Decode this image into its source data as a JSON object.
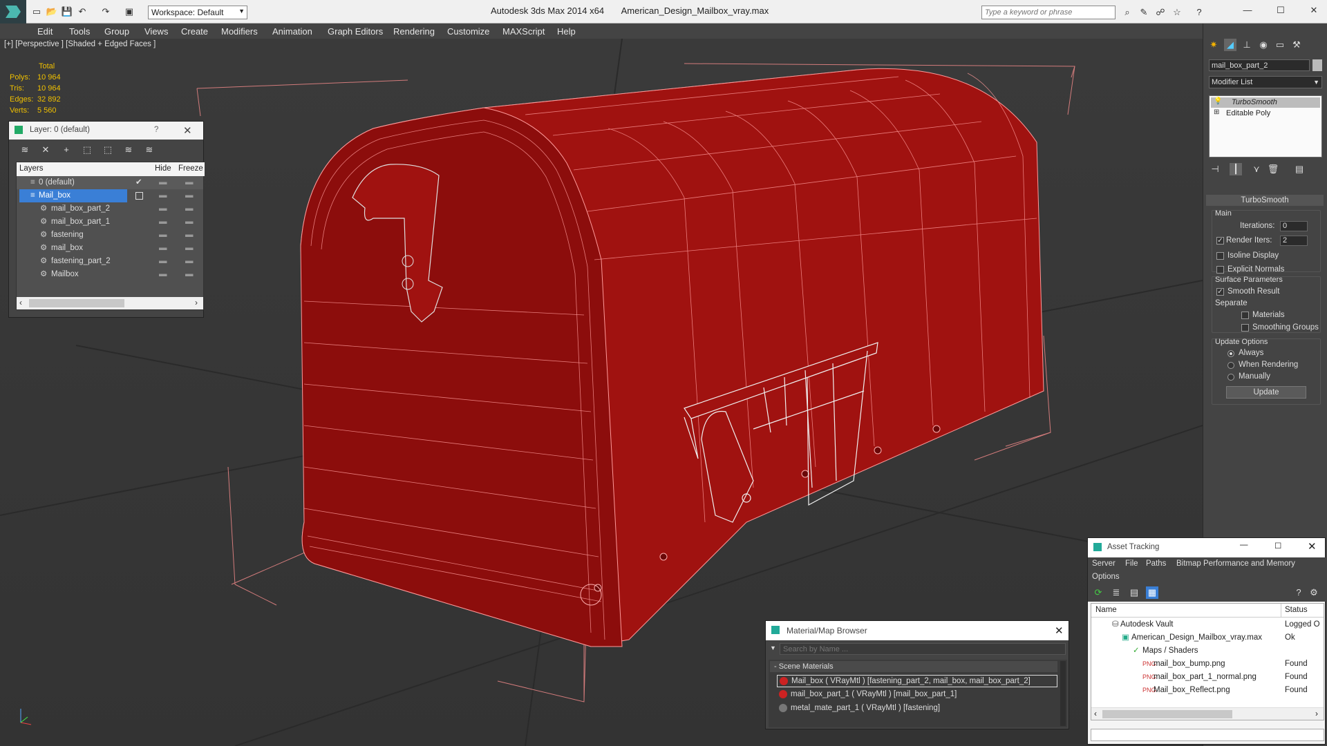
{
  "titlebar": {
    "app_title": "Autodesk 3ds Max  2014 x64",
    "file_title": "American_Design_Mailbox_vray.max",
    "workspace": "Workspace: Default",
    "search_placeholder": "Type a keyword or phrase"
  },
  "menu": [
    "Edit",
    "Tools",
    "Group",
    "Views",
    "Create",
    "Modifiers",
    "Animation",
    "Graph Editors",
    "Rendering",
    "Customize",
    "MAXScript",
    "Help"
  ],
  "viewport": {
    "label": "[+] [Perspective ] [Shaded + Edged Faces ]",
    "stats": {
      "header": "Total",
      "polys_label": "Polys:",
      "polys": "10 964",
      "tris_label": "Tris:",
      "tris": "10 964",
      "edges_label": "Edges:",
      "edges": "32 892",
      "verts_label": "Verts:",
      "verts": "5 560"
    }
  },
  "layer_window": {
    "title": "Layer: 0 (default)",
    "help": "?",
    "col_layers": "Layers",
    "col_hide": "Hide",
    "col_freeze": "Freeze",
    "rows": [
      {
        "name": "0 (default)"
      },
      {
        "name": "Mail_box"
      },
      {
        "name": "mail_box_part_2"
      },
      {
        "name": "mail_box_part_1"
      },
      {
        "name": "fastening"
      },
      {
        "name": "mail_box"
      },
      {
        "name": "fastening_part_2"
      },
      {
        "name": "Mailbox"
      }
    ]
  },
  "command_panel": {
    "object_name": "mail_box_part_2",
    "modifier_list": "Modifier List",
    "stack": [
      "TurboSmooth",
      "Editable Poly"
    ],
    "rollout_title": "TurboSmooth",
    "main_label": "Main",
    "iterations_label": "Iterations:",
    "iterations_value": "0",
    "render_iters_label": "Render Iters:",
    "render_iters_value": "2",
    "isoline": "Isoline Display",
    "explicit": "Explicit Normals",
    "surface_params": "Surface Parameters",
    "smooth_result": "Smooth Result",
    "separate": "Separate",
    "materials": "Materials",
    "smoothing_groups": "Smoothing Groups",
    "update_options": "Update Options",
    "always": "Always",
    "when_rendering": "When Rendering",
    "manually": "Manually",
    "update_btn": "Update"
  },
  "material_browser": {
    "title": "Material/Map Browser",
    "search_placeholder": "Search by Name ...",
    "group": "- Scene Materials",
    "items": [
      "Mail_box  ( VRayMtl ) [fastening_part_2, mail_box, mail_box_part_2]",
      "mail_box_part_1  ( VRayMtl ) [mail_box_part_1]",
      "metal_mate_part_1  ( VRayMtl ) [fastening]"
    ]
  },
  "asset_tracking": {
    "title": "Asset Tracking",
    "menu": [
      "Server",
      "File",
      "Paths",
      "Bitmap Performance and Memory"
    ],
    "menu2": "Options",
    "col_name": "Name",
    "col_status": "Status",
    "rows": [
      {
        "name": "Autodesk Vault",
        "status": "Logged O"
      },
      {
        "name": "American_Design_Mailbox_vray.max",
        "status": "Ok"
      },
      {
        "name": "Maps / Shaders",
        "status": ""
      },
      {
        "name": "mail_box_bump.png",
        "status": "Found"
      },
      {
        "name": "mail_box_part_1_normal.png",
        "status": "Found"
      },
      {
        "name": "Mail_box_Reflect.png",
        "status": "Found"
      }
    ]
  }
}
